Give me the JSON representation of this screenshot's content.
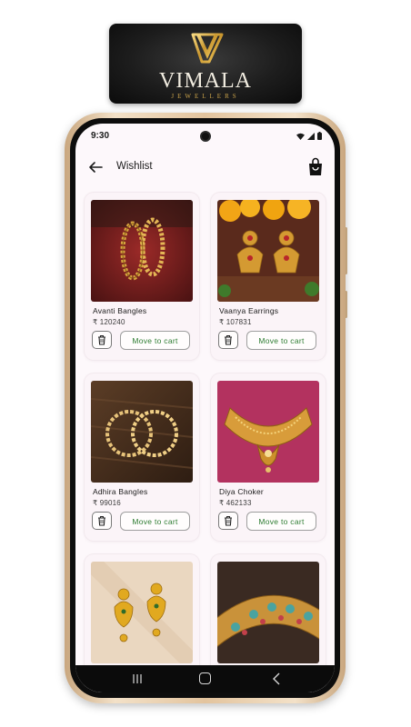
{
  "brand": {
    "name": "VIMALA",
    "tagline": "JEWELLERS",
    "logo_icon": "diamond-v-logo",
    "gold_color": "#c9a24a"
  },
  "status_bar": {
    "time": "9:30",
    "icons": [
      "wifi-icon",
      "signal-icon",
      "battery-icon"
    ]
  },
  "app_bar": {
    "title": "Wishlist",
    "back_icon": "arrow-left-icon",
    "cart_icon": "shopping-bag-icon"
  },
  "wishlist": {
    "items": [
      {
        "name": "Avanti Bangles",
        "price": "₹ 120240",
        "action": "Move to cart",
        "image": "gold-bangles-pair"
      },
      {
        "name": "Vaanya Earrings",
        "price": "₹ 107831",
        "action": "Move to cart",
        "image": "jhumka-earrings"
      },
      {
        "name": "Adhira Bangles",
        "price": "₹ 99016",
        "action": "Move to cart",
        "image": "twisted-bangles"
      },
      {
        "name": "Diya Choker",
        "price": "₹ 462133",
        "action": "Move to cart",
        "image": "gold-choker"
      },
      {
        "name": "",
        "price": "",
        "action": "",
        "image": "drop-earrings"
      },
      {
        "name": "",
        "price": "",
        "action": "",
        "image": "enamel-kada"
      }
    ]
  },
  "nav_bar": {
    "icons": [
      "recents-icon",
      "home-icon",
      "back-icon"
    ]
  },
  "colors": {
    "accent_green": "#2e7d32",
    "page_background": "#fdf8fb",
    "frame_gold": "#e3c49e"
  }
}
